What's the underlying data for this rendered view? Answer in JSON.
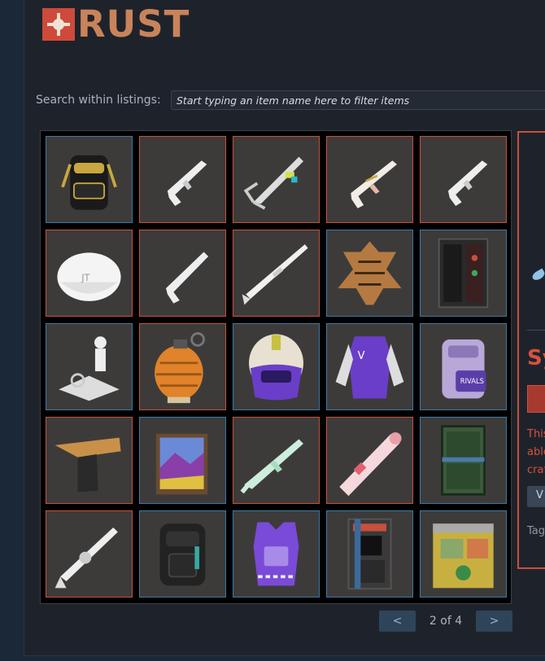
{
  "brand": {
    "logo_text": "RUST",
    "accent": "#ce4a3a"
  },
  "search": {
    "label": "Search within listings:",
    "placeholder": "Start typing an item name here to filter items"
  },
  "items": [
    {
      "name": "black-backpack",
      "border": "blue"
    },
    {
      "name": "white-ak-rifle",
      "border": "red"
    },
    {
      "name": "white-ak-folding-stock",
      "border": "red"
    },
    {
      "name": "white-ak-gold-accents",
      "border": "red"
    },
    {
      "name": "white-ak-rifle-2",
      "border": "red"
    },
    {
      "name": "white-cap",
      "border": "red"
    },
    {
      "name": "white-ak-rifle-3",
      "border": "red"
    },
    {
      "name": "white-bolt-rifle",
      "border": "red"
    },
    {
      "name": "tiger-rug",
      "border": "blue"
    },
    {
      "name": "vending-locker",
      "border": "blue"
    },
    {
      "name": "white-crafting-station",
      "border": "blue"
    },
    {
      "name": "orange-grenade",
      "border": "red"
    },
    {
      "name": "purple-helmet",
      "border": "blue"
    },
    {
      "name": "purple-varsity-jacket",
      "border": "blue"
    },
    {
      "name": "purple-backpack",
      "border": "blue"
    },
    {
      "name": "gold-pistol",
      "border": "red"
    },
    {
      "name": "painting-easel",
      "border": "blue"
    },
    {
      "name": "mint-smg",
      "border": "red"
    },
    {
      "name": "pink-rocket-launcher",
      "border": "red"
    },
    {
      "name": "green-door",
      "border": "blue"
    },
    {
      "name": "white-thompson",
      "border": "red"
    },
    {
      "name": "dark-backpack",
      "border": "blue"
    },
    {
      "name": "purple-chest-armor",
      "border": "blue"
    },
    {
      "name": "arcade-vending-machine",
      "border": "blue"
    },
    {
      "name": "recycler-box",
      "border": "blue"
    }
  ],
  "pager": {
    "prev": "<",
    "next": ">",
    "status": "2 of 4"
  },
  "detail": {
    "title": "Sy",
    "desc_line1": "This",
    "desc_line2": "able",
    "desc_line3": "craf",
    "view_label": "V",
    "tags_label": "Tag"
  }
}
